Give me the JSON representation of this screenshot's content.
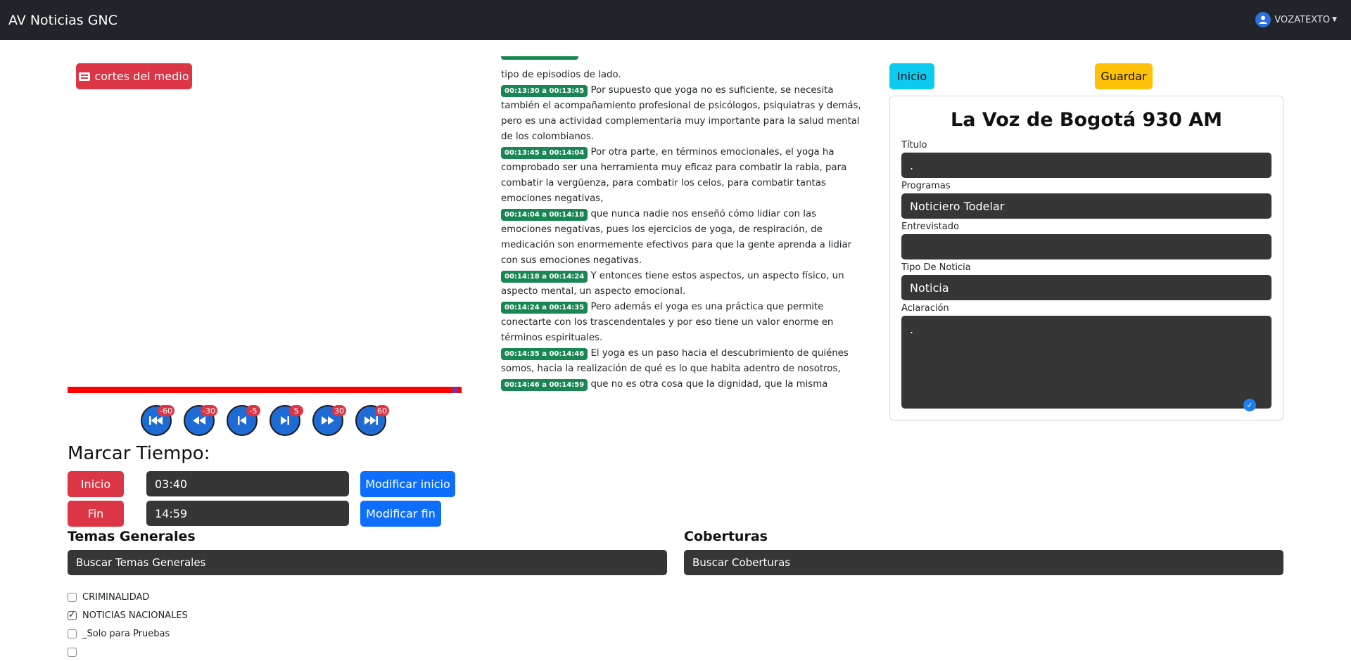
{
  "navbar": {
    "brand": "AV Noticias GNC",
    "user": "VOZATEXTO"
  },
  "player": {
    "cortes_button": "cortes del medio",
    "progress_fraction": 0.984,
    "buttons": [
      {
        "icon": "skip-back-icon",
        "badge": "-60"
      },
      {
        "icon": "rewind-icon",
        "badge": "-30"
      },
      {
        "icon": "step-back-icon",
        "badge": "-5"
      },
      {
        "icon": "step-forward-icon",
        "badge": "5"
      },
      {
        "icon": "fast-forward-icon",
        "badge": "30"
      },
      {
        "icon": "skip-forward-icon",
        "badge": "60"
      }
    ]
  },
  "marcar": {
    "title": "Marcar Tiempo:",
    "inicio_label": "Inicio",
    "inicio_value": "03:40",
    "modificar_inicio": "Modificar inicio",
    "fin_label": "Fin",
    "fin_value": "14:59",
    "modificar_fin": "Modificar fin"
  },
  "temas": {
    "title": "Temas Generales",
    "placeholder": "Buscar Temas Generales",
    "items": [
      {
        "label": "CRIMINALIDAD",
        "checked": false
      },
      {
        "label": "NOTICIAS NACIONALES",
        "checked": true
      },
      {
        "label": "_Solo para Pruebas",
        "checked": false
      }
    ]
  },
  "coberturas": {
    "title": "Coberturas",
    "placeholder": "Buscar Coberturas"
  },
  "transcript": {
    "lead_text": "tipo de episodios de lado.",
    "segments": [
      {
        "time": "00:13:30 a 00:13:45",
        "text": "Por supuesto que yoga no es suficiente, se necesita también el acompañamiento profesional de psicólogos, psiquiatras y demás, pero es una actividad complementaria muy importante para la salud mental de los colombianos."
      },
      {
        "time": "00:13:45 a 00:14:04",
        "text": "Por otra parte, en términos emocionales, el yoga ha comprobado ser una herramienta muy eficaz para combatir la rabia, para combatir la vergüenza, para combatir los celos, para combatir tantas emociones negativas,"
      },
      {
        "time": "00:14:04 a 00:14:18",
        "text": "que nunca nadie nos enseñó cómo lidiar con las emociones negativas, pues los ejercicios de yoga, de respiración, de medicación son enormemente efectivos para que la gente aprenda a lidiar con sus emociones negativas."
      },
      {
        "time": "00:14:18 a 00:14:24",
        "text": "Y entonces tiene estos aspectos, un aspecto físico, un aspecto mental, un aspecto emocional."
      },
      {
        "time": "00:14:24 a 00:14:35",
        "text": "Pero además el yoga es una práctica que permite conectarte con los trascendentales y por eso tiene un valor enorme en términos espirituales."
      },
      {
        "time": "00:14:35 a 00:14:46",
        "text": "El yoga es un paso hacia el descubrimiento de quiénes somos, hacia la realización de qué es lo que habita adentro de nosotros,"
      },
      {
        "time": "00:14:46 a 00:14:59",
        "text": "que no es otra cosa que la dignidad, que la misma energía la podemos experimentar, esa energía que hace que todo sea, esa energía básica de esta creación."
      }
    ]
  },
  "form": {
    "inicio_button": "Inicio",
    "guardar_button": "Guardar",
    "station": "La Voz de Bogotá 930 AM",
    "titulo_label": "Título",
    "titulo_value": ".",
    "programas_label": "Programas",
    "programas_value": "Noticiero Todelar",
    "entrevistado_label": "Entrevistado",
    "entrevistado_value": "",
    "tipo_label": "Tipo De Noticia",
    "tipo_value": "Noticia",
    "aclaracion_label": "Aclaración",
    "aclaracion_value": "."
  }
}
